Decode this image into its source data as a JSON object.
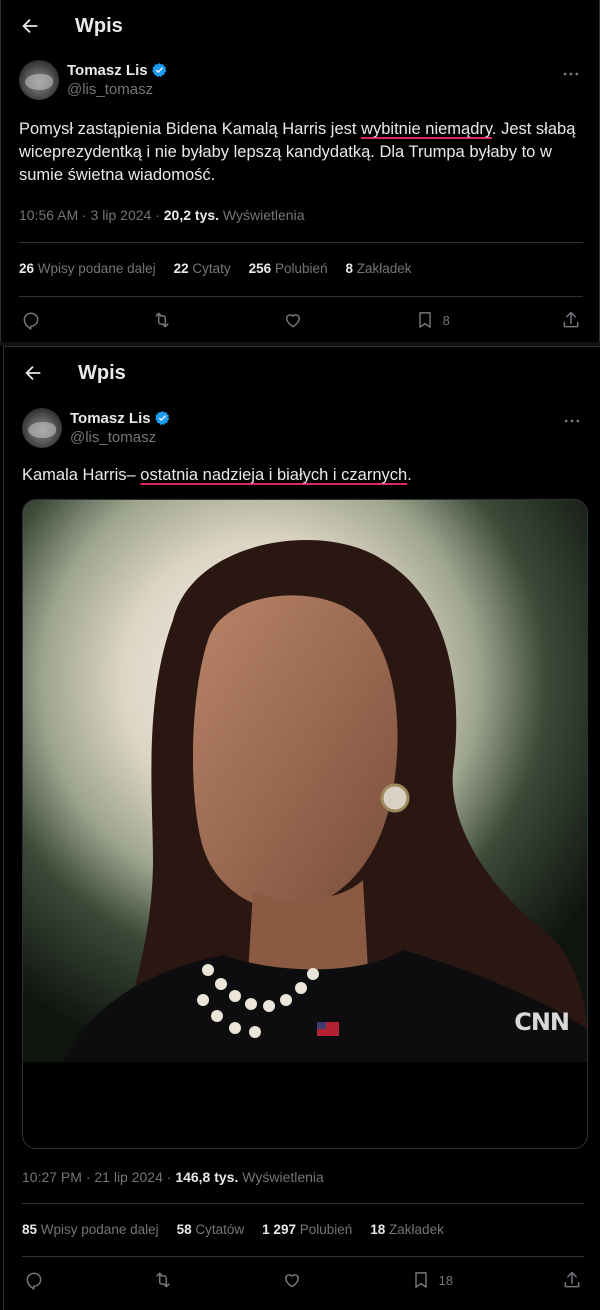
{
  "colors": {
    "background": "#000000",
    "text": "#e7e9ea",
    "muted": "#71767b",
    "divider": "#2f3336",
    "verified": "#1d9bf0",
    "underline": "#e0245e"
  },
  "posts": [
    {
      "header_title": "Wpis",
      "author": {
        "name": "Tomasz Lis",
        "handle": "@lis_tomasz",
        "verified": true
      },
      "text_parts": {
        "a": "Pomysł zastąpienia Bidena Kamalą Harris jest ",
        "u": "wybitnie niemądry",
        "b": ". Jest słabą  wiceprezydentką i nie byłaby lepszą kandydatką. Dla Trumpa byłaby to w sumie świetna wiadomość."
      },
      "timestamp": "10:56 AM · 3 lip 2024 · ",
      "views_count": "20,2 tys.",
      "views_label": " Wyświetlenia",
      "stats": [
        {
          "count": "26",
          "label": " Wpisy podane dalej"
        },
        {
          "count": "22",
          "label": " Cytaty"
        },
        {
          "count": "256",
          "label": " Polubień"
        },
        {
          "count": "8",
          "label": " Zakładek"
        }
      ],
      "bookmark_count": "8"
    },
    {
      "header_title": "Wpis",
      "author": {
        "name": "Tomasz Lis",
        "handle": "@lis_tomasz",
        "verified": true
      },
      "text_parts": {
        "a": "Kamala Harris– ",
        "u": "ostatnia nadzieja i białych i czarnych",
        "b": "."
      },
      "image_watermark": "CNN",
      "timestamp": "10:27 PM · 21 lip 2024 · ",
      "views_count": "146,8 tys.",
      "views_label": " Wyświetlenia",
      "stats": [
        {
          "count": "85",
          "label": " Wpisy podane dalej"
        },
        {
          "count": "58",
          "label": " Cytatów"
        },
        {
          "count": "1 297",
          "label": " Polubień"
        },
        {
          "count": "18",
          "label": " Zakładek"
        }
      ],
      "bookmark_count": "18"
    }
  ]
}
